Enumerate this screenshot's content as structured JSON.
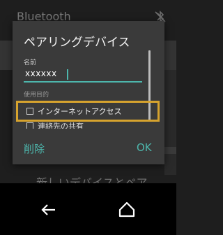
{
  "background": {
    "title": "Bluetooth",
    "pair_item": "新しいデバイスとペア"
  },
  "dialog": {
    "title": "ペアリングデバイス",
    "name_label": "名前",
    "name_value": "xxxxxx",
    "purpose_label": "使用目的",
    "options": [
      {
        "label": "インターネットアクセス",
        "checked": false
      },
      {
        "label": "連絡先の共有",
        "checked": false
      }
    ],
    "delete_label": "削除",
    "ok_label": "OK"
  },
  "colors": {
    "accent": "#4db6ac",
    "highlight": "#d6a32e",
    "dialog_bg": "#3a3a3a"
  }
}
